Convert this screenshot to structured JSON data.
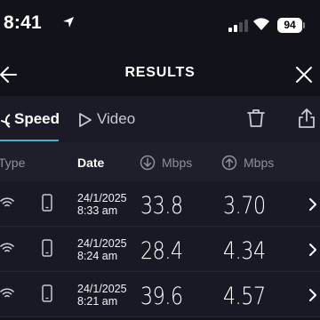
{
  "status_bar": {
    "time": "8:41",
    "battery": "94"
  },
  "header": {
    "title": "RESULTS"
  },
  "tabs": [
    {
      "label": "Speed",
      "active": true
    },
    {
      "label": "Video",
      "active": false
    }
  ],
  "columns": {
    "type": "Type",
    "date": "Date",
    "download_unit": "Mbps",
    "upload_unit": "Mbps"
  },
  "results": [
    {
      "date": "24/1/2025",
      "time": "8:33 am",
      "download": "33.8",
      "upload": "3.70"
    },
    {
      "date": "24/1/2025",
      "time": "8:24 am",
      "download": "28.4",
      "upload": "4.34"
    },
    {
      "date": "24/1/2025",
      "time": "8:21 am",
      "download": "39.6",
      "upload": "4.57"
    }
  ],
  "colors": {
    "accent": "#3db2d6",
    "background": "#11121a",
    "row": "#181924"
  },
  "icons": [
    "location-arrow-icon",
    "signal-icon",
    "wifi-icon",
    "battery-icon",
    "back-arrow-icon",
    "close-icon",
    "speed-gauge-icon",
    "play-icon",
    "trash-icon",
    "share-icon",
    "download-icon",
    "upload-icon",
    "phone-icon",
    "chevron-right-icon"
  ]
}
